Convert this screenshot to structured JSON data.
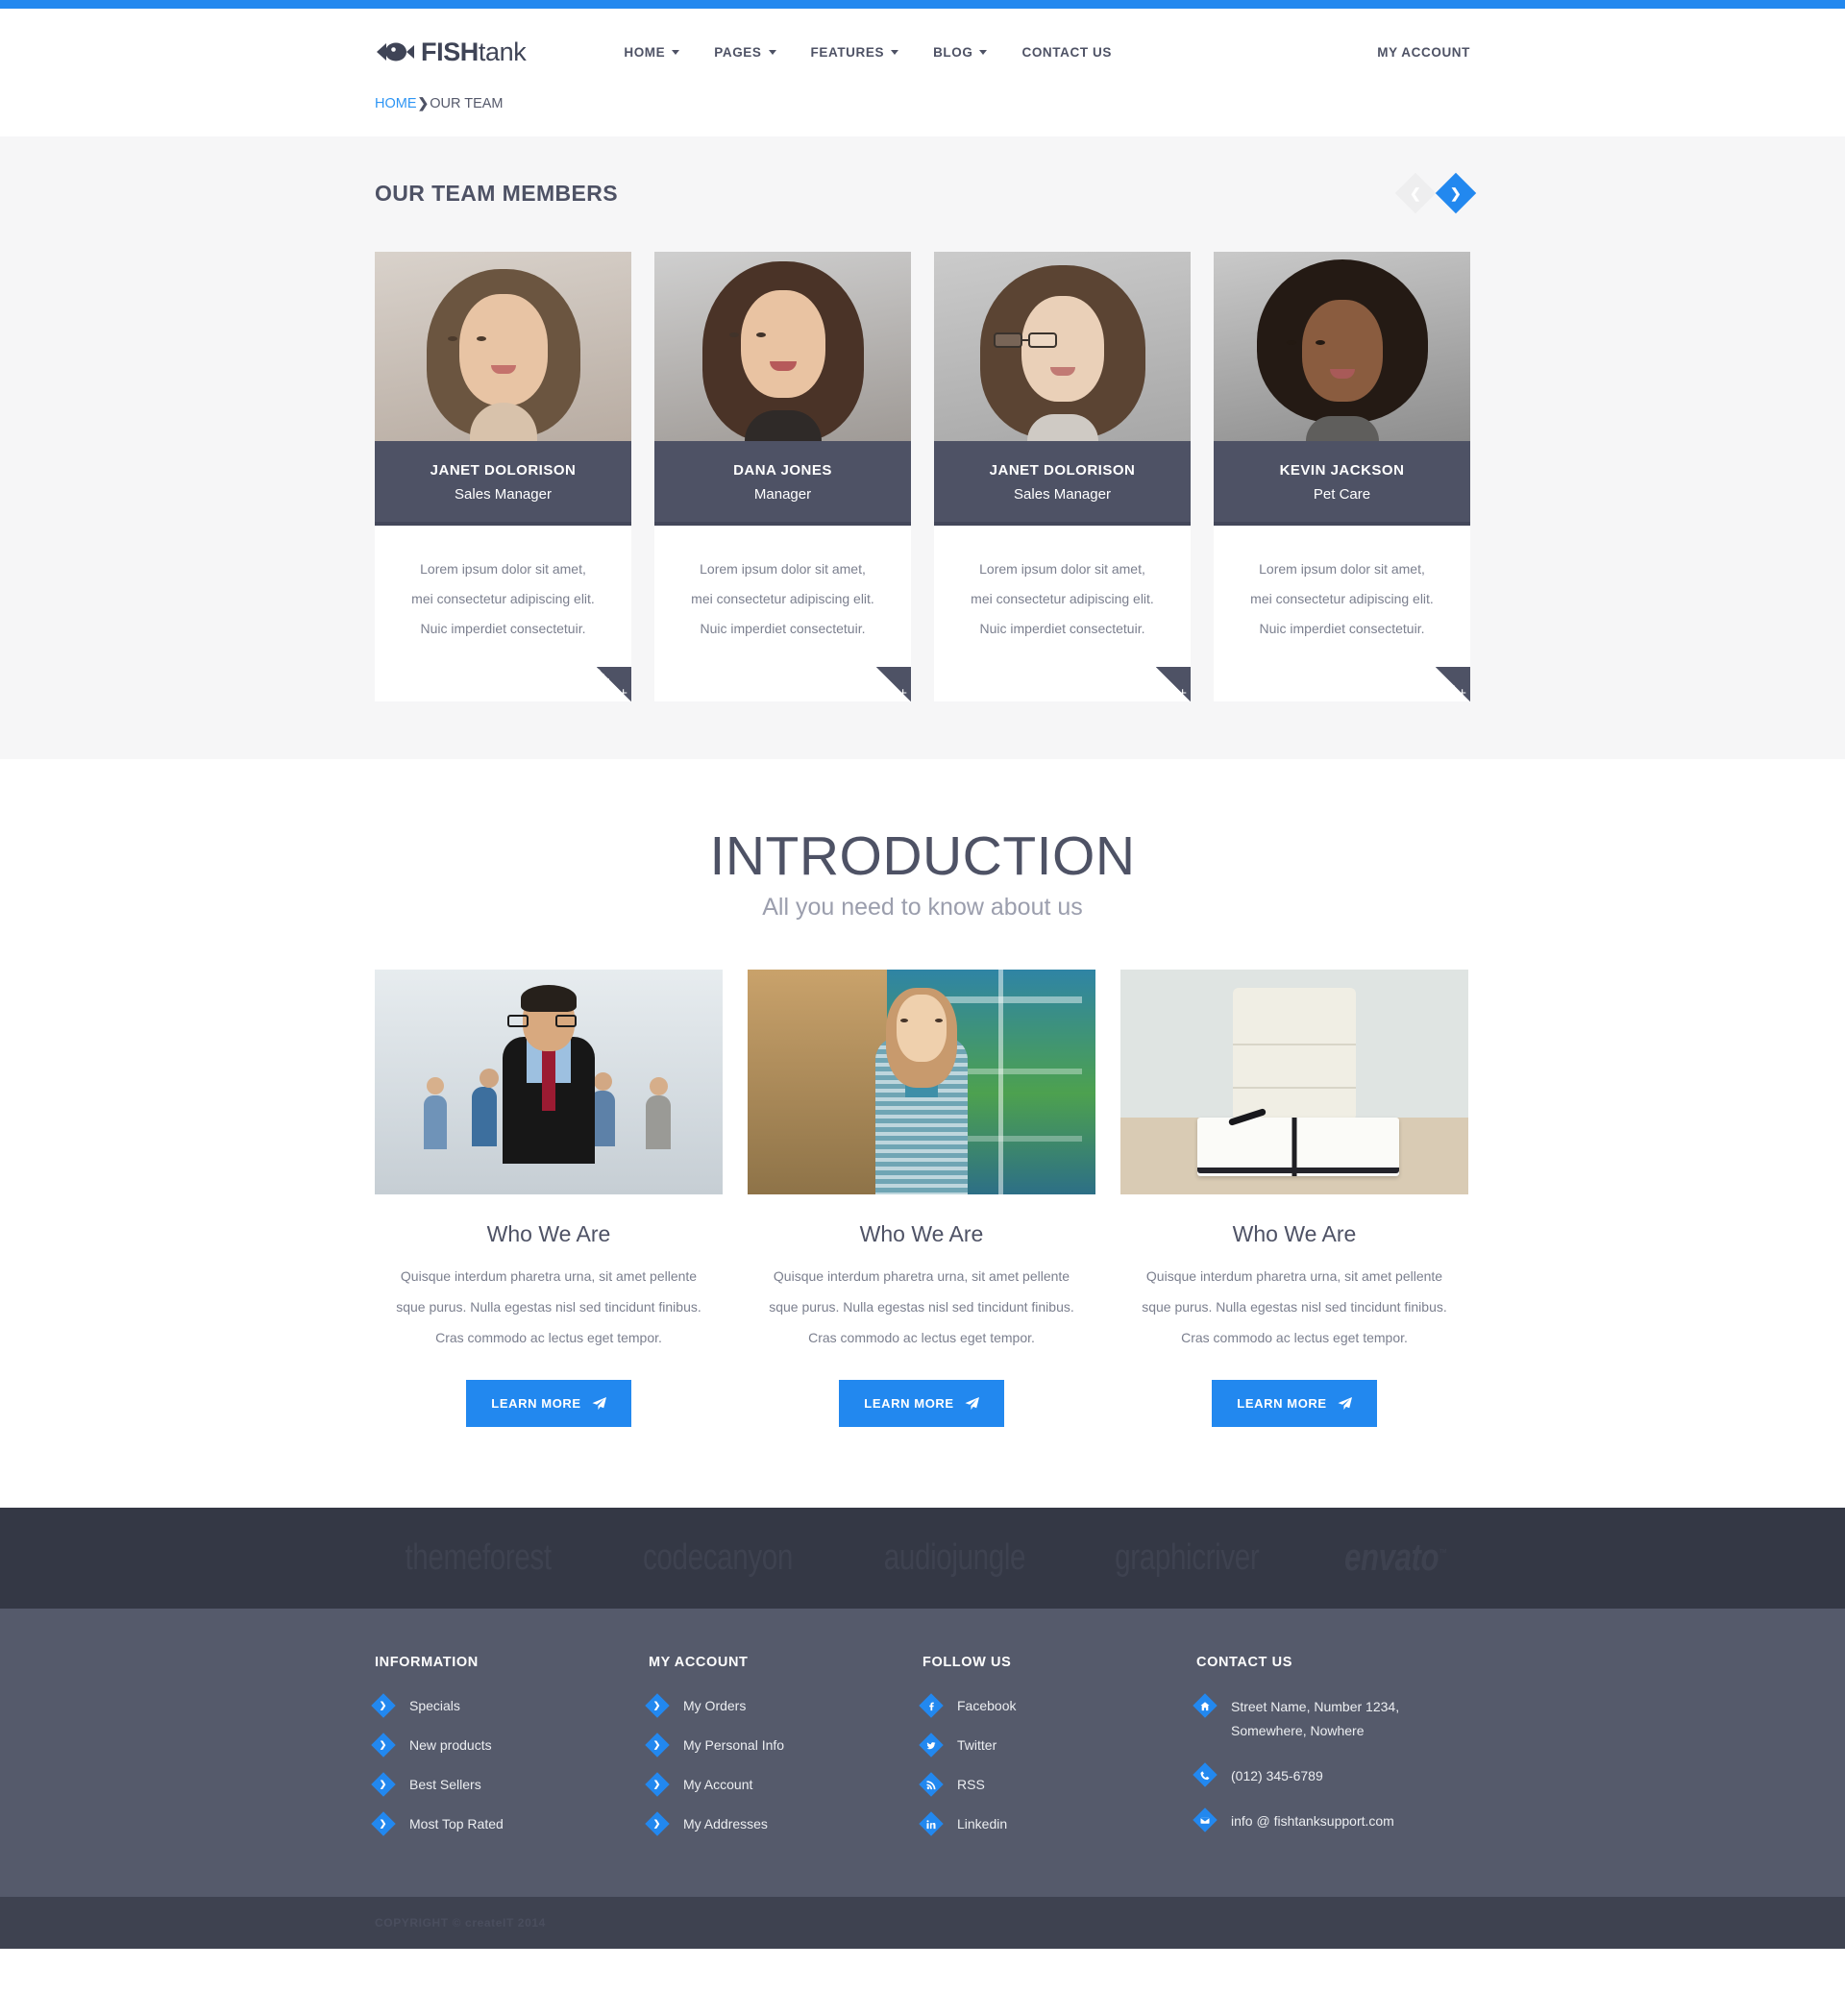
{
  "header": {
    "logo_text_bold": "FISH",
    "logo_text_light": "tank",
    "nav": [
      {
        "label": "HOME",
        "has_caret": true
      },
      {
        "label": "PAGES",
        "has_caret": true
      },
      {
        "label": "FEATURES",
        "has_caret": true
      },
      {
        "label": "BLOG",
        "has_caret": true
      },
      {
        "label": "CONTACT US",
        "has_caret": false
      }
    ],
    "my_account": "MY ACCOUNT"
  },
  "breadcrumb": {
    "home": "HOME",
    "separator": "❯",
    "current": "OUR TEAM"
  },
  "team": {
    "title": "OUR TEAM MEMBERS",
    "prev_icon": "chevron-left-icon",
    "next_icon": "chevron-right-icon",
    "prev_glyph": "❮",
    "next_glyph": "❯",
    "plus_glyph": "+",
    "members": [
      {
        "name": "JANET DOLORISON",
        "role": "Sales Manager",
        "bio_line1": "Lorem ipsum dolor sit amet,",
        "bio_line2": "mei consectetur adipiscing elit.",
        "bio_line3": "Nuic imperdiet consectetuir."
      },
      {
        "name": "DANA JONES",
        "role": "Manager",
        "bio_line1": "Lorem ipsum dolor sit amet,",
        "bio_line2": "mei consectetur adipiscing elit.",
        "bio_line3": "Nuic imperdiet consectetuir."
      },
      {
        "name": "JANET DOLORISON",
        "role": "Sales Manager",
        "bio_line1": "Lorem ipsum dolor sit amet,",
        "bio_line2": "mei consectetur adipiscing elit.",
        "bio_line3": "Nuic imperdiet consectetuir."
      },
      {
        "name": "KEVIN JACKSON",
        "role": "Pet Care",
        "bio_line1": "Lorem ipsum dolor sit amet,",
        "bio_line2": "mei consectetur adipiscing elit.",
        "bio_line3": "Nuic imperdiet consectetuir."
      }
    ]
  },
  "intro": {
    "title": "INTRODUCTION",
    "subtitle": "All you need to know about us",
    "columns": [
      {
        "heading": "Who We Are",
        "line1": "Quisque interdum pharetra urna, sit amet pellente",
        "line2": "sque purus. Nulla egestas nisl sed tincidunt finibus.",
        "line3": "Cras commodo ac lectus eget tempor.",
        "button": "LEARN MORE"
      },
      {
        "heading": "Who We Are",
        "line1": "Quisque interdum pharetra urna, sit amet pellente",
        "line2": "sque purus. Nulla egestas nisl sed tincidunt finibus.",
        "line3": "Cras commodo ac lectus eget tempor.",
        "button": "LEARN MORE"
      },
      {
        "heading": "Who We Are",
        "line1": "Quisque interdum pharetra urna, sit amet pellente",
        "line2": "sque purus. Nulla egestas nisl sed tincidunt finibus.",
        "line3": "Cras commodo ac lectus eget tempor.",
        "button": "LEARN MORE"
      }
    ]
  },
  "brands": [
    {
      "name": "themeforest"
    },
    {
      "name": "codecanyon"
    },
    {
      "name": "audiojungle"
    },
    {
      "name": "graphicriver"
    },
    {
      "name": "envato",
      "tm": "™"
    }
  ],
  "footer": {
    "information": {
      "title": "INFORMATION",
      "links": [
        "Specials",
        "New products",
        "Best Sellers",
        "Most Top Rated"
      ]
    },
    "my_account": {
      "title": "MY ACCOUNT",
      "links": [
        "My Orders",
        "My Personal Info",
        "My Account",
        "My Addresses"
      ]
    },
    "follow_us": {
      "title": "FOLLOW US",
      "links": [
        {
          "label": "Facebook",
          "icon": "facebook-icon",
          "glyph": "f"
        },
        {
          "label": "Twitter",
          "icon": "twitter-icon",
          "glyph": "t"
        },
        {
          "label": "RSS",
          "icon": "rss-icon",
          "glyph": "r"
        },
        {
          "label": "Linkedin",
          "icon": "linkedin-icon",
          "glyph": "in"
        }
      ]
    },
    "contact_us": {
      "title": "CONTACT US",
      "items": [
        {
          "label": "Street Name, Number 1234, Somewhere, Nowhere",
          "icon": "home-icon"
        },
        {
          "label": "(012) 345-6789",
          "icon": "phone-icon"
        },
        {
          "label": "info @ fishtanksupport.com",
          "icon": "envelope-icon"
        }
      ]
    },
    "copyright": "COPYRIGHT © createIT 2014"
  },
  "colors": {
    "accent_blue": "#2288ef",
    "dark_slate": "#4e5265",
    "footer_bg": "#555a6b",
    "brands_bg": "#343845",
    "copyright_bg": "#3e4250",
    "section_bg": "#f6f6f7"
  }
}
